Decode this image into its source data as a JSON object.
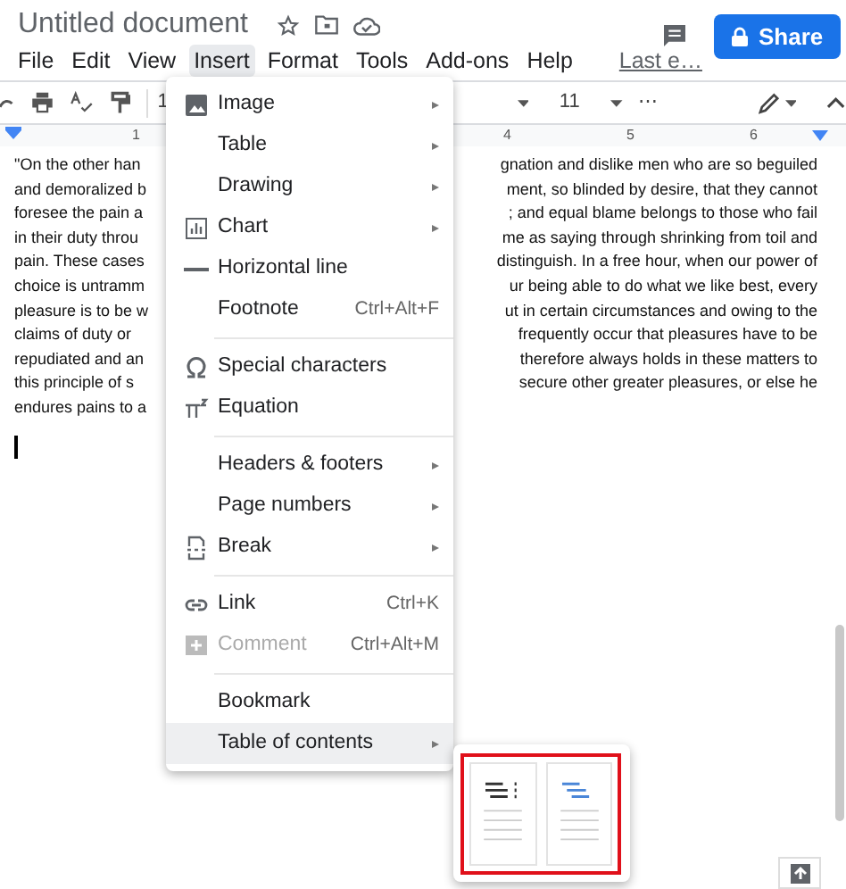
{
  "document_title": "Untitled document",
  "menu_bar": [
    {
      "label": "File",
      "selected": false
    },
    {
      "label": "Edit",
      "selected": false
    },
    {
      "label": "View",
      "selected": false
    },
    {
      "label": "Insert",
      "selected": true
    },
    {
      "label": "Format",
      "selected": false
    },
    {
      "label": "Tools",
      "selected": false
    },
    {
      "label": "Add-ons",
      "selected": false
    },
    {
      "label": "Help",
      "selected": false
    }
  ],
  "last_edit": "Last e…",
  "share_button": "Share",
  "toolbar": {
    "zoom": "1",
    "font_size": "11",
    "more": "⋯"
  },
  "ruler": [
    "1",
    "4",
    "5",
    "6"
  ],
  "document_lines": [
    {
      "left": "\"On the other han",
      "right": "gnation and dislike men who are so beguiled"
    },
    {
      "left": "and demoralized b",
      "right": "ment, so blinded by desire, that they cannot"
    },
    {
      "left": "foresee the pain a",
      "right": "; and equal blame belongs to those who fail"
    },
    {
      "left": "in their duty throu",
      "right": "me as saying through shrinking from toil and"
    },
    {
      "left": "pain. These cases",
      "right": "distinguish. In a free hour, when our power of"
    },
    {
      "left": "choice is untramm",
      "right": "ur being able to do what we like best, every"
    },
    {
      "left": "pleasure is to be w",
      "right": "ut in certain circumstances and owing to the"
    },
    {
      "left": "claims of duty or",
      "right": "frequently occur that pleasures have to be"
    },
    {
      "left": "repudiated and an",
      "right": "therefore always holds in these matters to"
    },
    {
      "left": "this principle of s",
      "right": "secure other greater pleasures, or else he"
    },
    {
      "left": "endures pains to a"
    }
  ],
  "insert_menu": [
    {
      "kind": "item",
      "label": "Image",
      "submenu": true,
      "disabled": false,
      "selected": false
    },
    {
      "kind": "item",
      "label": "Table",
      "submenu": true,
      "disabled": false,
      "selected": false
    },
    {
      "kind": "item",
      "label": "Drawing",
      "submenu": true,
      "disabled": false,
      "selected": false
    },
    {
      "kind": "item",
      "label": "Chart",
      "submenu": true,
      "disabled": false,
      "selected": false
    },
    {
      "kind": "item",
      "label": "Horizontal line",
      "submenu": false,
      "disabled": false,
      "selected": false
    },
    {
      "kind": "item",
      "label": "Footnote",
      "shortcut": "Ctrl+Alt+F",
      "submenu": false,
      "disabled": false,
      "selected": false
    },
    {
      "kind": "divider"
    },
    {
      "kind": "item",
      "label": "Special characters",
      "submenu": false,
      "disabled": false,
      "selected": false
    },
    {
      "kind": "item",
      "label": "Equation",
      "submenu": false,
      "disabled": false,
      "selected": false
    },
    {
      "kind": "divider"
    },
    {
      "kind": "item",
      "label": "Headers & footers",
      "submenu": true,
      "disabled": false,
      "selected": false
    },
    {
      "kind": "item",
      "label": "Page numbers",
      "submenu": true,
      "disabled": false,
      "selected": false
    },
    {
      "kind": "item",
      "label": "Break",
      "submenu": true,
      "disabled": false,
      "selected": false
    },
    {
      "kind": "divider"
    },
    {
      "kind": "item",
      "label": "Link",
      "shortcut": "Ctrl+K",
      "submenu": false,
      "disabled": false,
      "selected": false
    },
    {
      "kind": "item",
      "label": "Comment",
      "shortcut": "Ctrl+Alt+M",
      "submenu": false,
      "disabled": true,
      "selected": false
    },
    {
      "kind": "divider"
    },
    {
      "kind": "item",
      "label": "Bookmark",
      "submenu": false,
      "disabled": false,
      "selected": false
    },
    {
      "kind": "item",
      "label": "Table of contents",
      "submenu": true,
      "disabled": false,
      "selected": true
    }
  ]
}
